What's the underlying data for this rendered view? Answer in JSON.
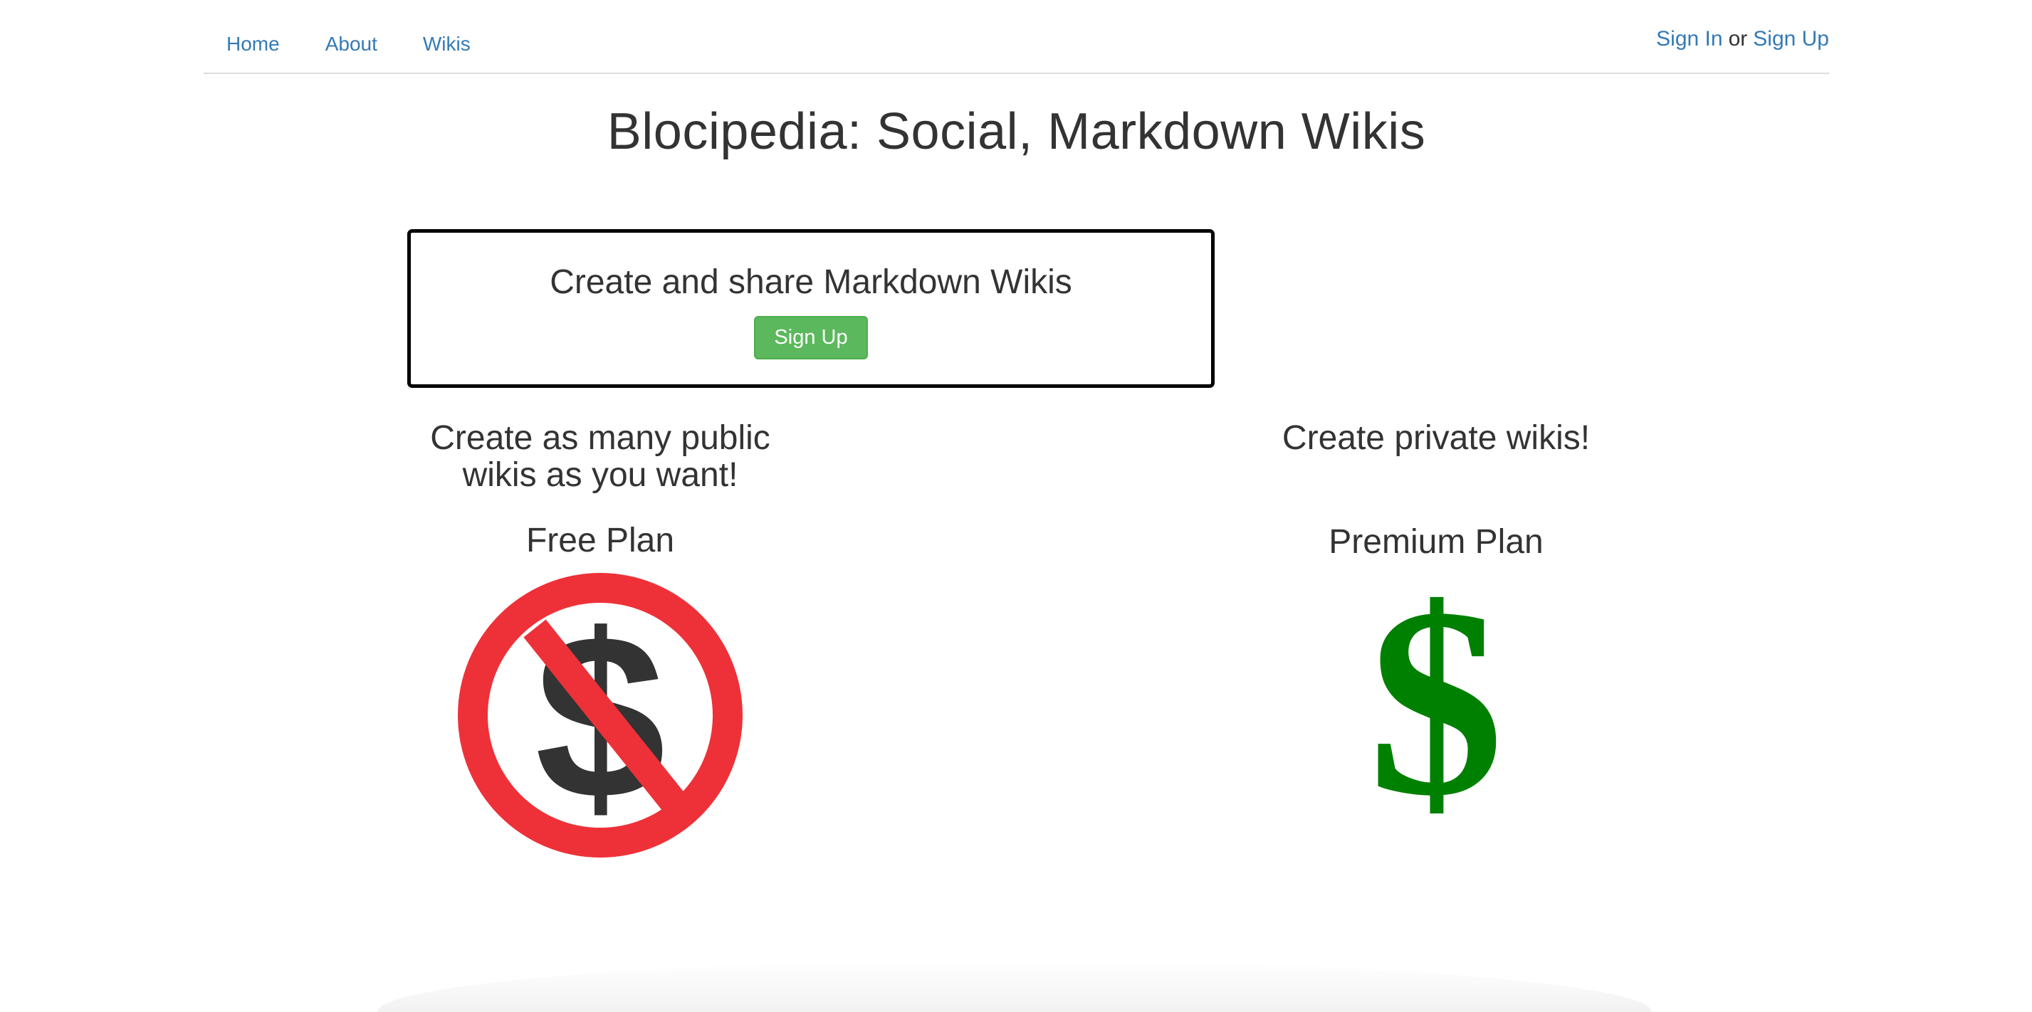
{
  "nav": {
    "links": [
      {
        "label": "Home"
      },
      {
        "label": "About"
      },
      {
        "label": "Wikis"
      }
    ],
    "auth": {
      "sign_in": "Sign In",
      "or": "or",
      "sign_up": "Sign Up"
    }
  },
  "main": {
    "title": "Blocipedia: Social, Markdown Wikis",
    "jumbotron": {
      "heading": "Create and share Markdown Wikis",
      "button": "Sign Up"
    },
    "free": {
      "heading_line1": "Create as many public",
      "heading_line2": "wikis as you want!",
      "plan": "Free Plan",
      "icon": "no-dollar-icon"
    },
    "premium": {
      "heading": "Create private wikis!",
      "plan": "Premium Plan",
      "icon": "dollar-icon"
    }
  },
  "colors": {
    "link": "#337ab7",
    "button": "#5cb85c",
    "prohibit_red": "#ee3138",
    "dollar_green": "#008000",
    "text": "#333333"
  }
}
